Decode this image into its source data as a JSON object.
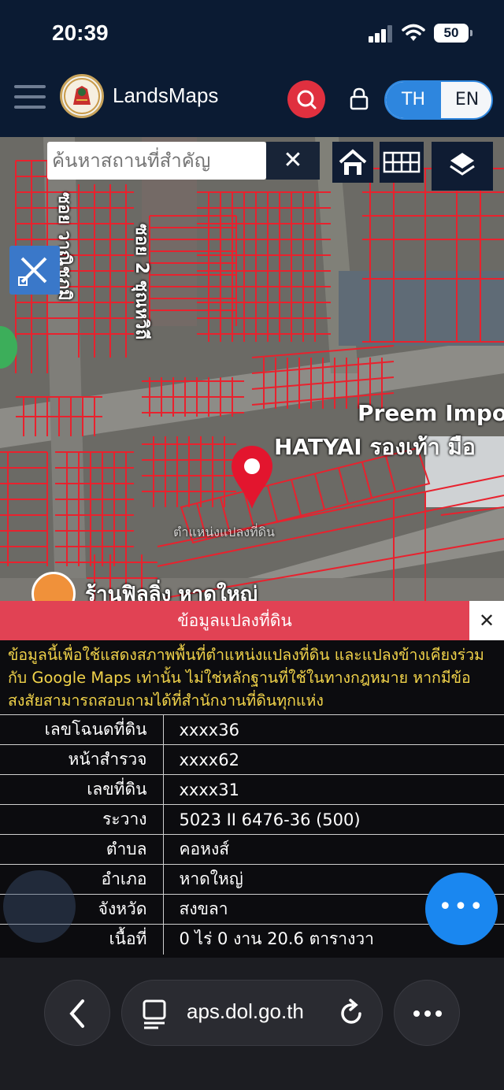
{
  "status_bar": {
    "time": "20:39",
    "battery": "50"
  },
  "app_bar": {
    "title": "LandsMaps",
    "lang_th": "TH",
    "lang_en": "EN"
  },
  "map": {
    "search_placeholder": "ค้นหาสถานที่สำคัญ",
    "clear_label": "✕",
    "labels": {
      "store_name": "Preem Impo",
      "store_line2": "HATYAI รองเท้า มือ",
      "shop": "ร้านฟิลลิ่ง หาดใหญ่",
      "street1": "ซอย 2 ชุณหวิถี",
      "street2": "ซอย วาณิชภูมิ",
      "parcel_text": "ตำแหน่งแปลงที่ดิน"
    }
  },
  "panel": {
    "title": "ข้อมูลแปลงที่ดิน",
    "close_label": "✕",
    "disclaimer": "ข้อมูลนี้เพื่อใช้แสดงสภาพพื้นที่ตำแหน่งแปลงที่ดิน และแปลงข้างเคียงร่วมกับ Google Maps เท่านั้น ไม่ใช่หลักฐานที่ใช้ในทางกฎหมาย หากมีข้อสงสัยสามารถสอบถามได้ที่สำนักงานที่ดินทุกแห่ง",
    "rows": [
      {
        "key": "เลขโฉนดที่ดิน",
        "value": "xxxx36"
      },
      {
        "key": "หน้าสำรวจ",
        "value": "xxxx62"
      },
      {
        "key": "เลขที่ดิน",
        "value": "xxxx31"
      },
      {
        "key": "ระวาง",
        "value": "5023 II 6476-36 (500)"
      },
      {
        "key": "ตำบล",
        "value": "คอหงส์"
      },
      {
        "key": "อำเภอ",
        "value": "หาดใหญ่"
      },
      {
        "key": "จังหวัด",
        "value": "สงขลา"
      },
      {
        "key": "เนื้อที่",
        "value": "0 ไร่ 0 งาน 20.6 ตารางวา"
      }
    ]
  },
  "fab": {
    "label": "•••"
  },
  "browser": {
    "url": "aps.dol.go.th"
  },
  "colors": {
    "accent_red": "#e14254",
    "brand_blue": "#2e86de",
    "parcel_line": "#e8222e",
    "disclaimer_text": "#f1d34a"
  }
}
